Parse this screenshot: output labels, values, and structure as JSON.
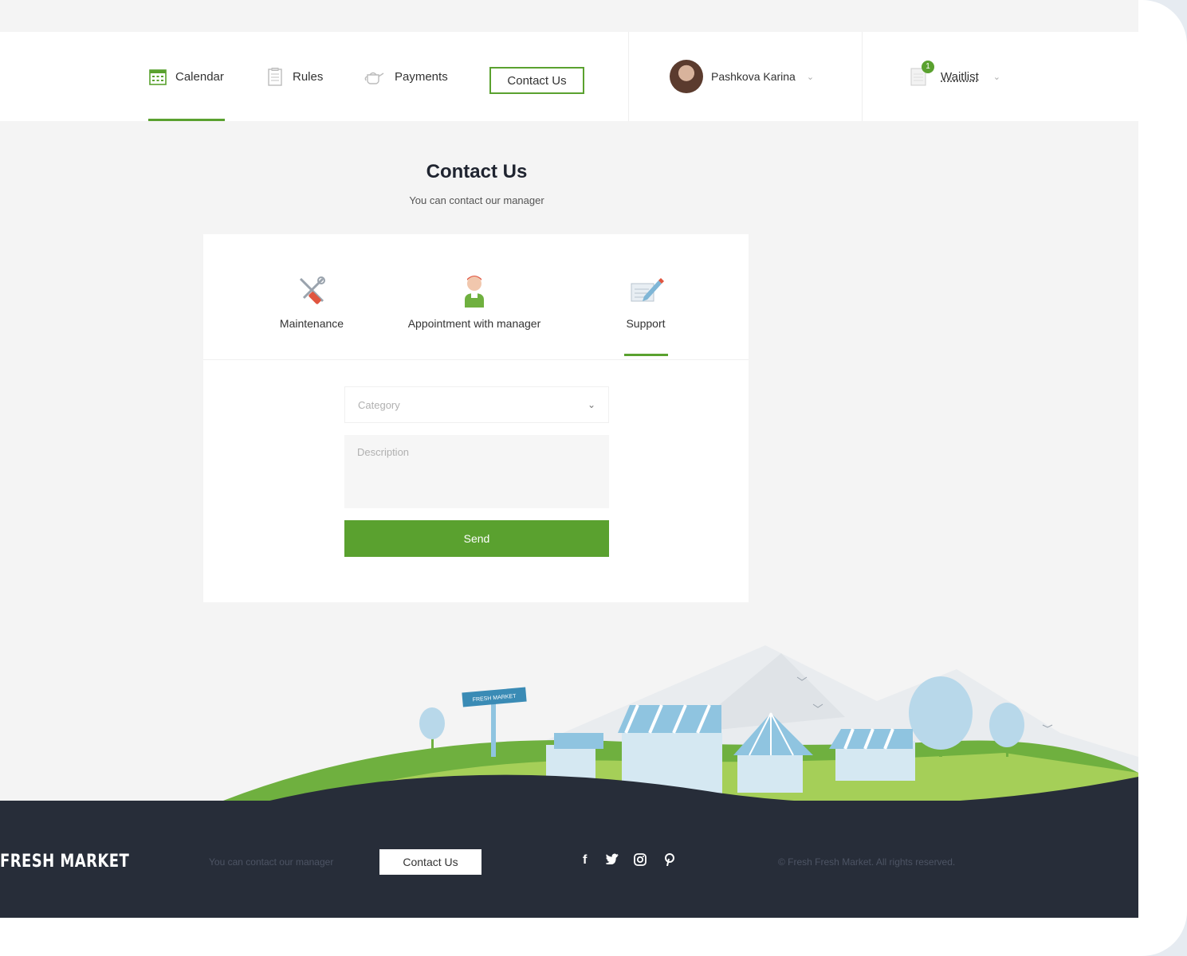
{
  "nav": {
    "calendar": "Calendar",
    "rules": "Rules",
    "payments": "Payments",
    "contact": "Contact Us"
  },
  "user": {
    "name": "Pashkova Karina"
  },
  "waitlist": {
    "label": "Waitlist",
    "badge": "1"
  },
  "page": {
    "title": "Contact Us",
    "subtitle": "You can contact our manager"
  },
  "tabs": [
    {
      "label": "Maintenance",
      "icon": "tools-icon"
    },
    {
      "label": "Appointment with manager",
      "icon": "manager-icon"
    },
    {
      "label": "Support",
      "icon": "support-icon",
      "active": true
    }
  ],
  "form": {
    "category_placeholder": "Category",
    "description_placeholder": "Description",
    "send_label": "Send"
  },
  "illustration": {
    "sign_text": "FRESH MARKET"
  },
  "footer": {
    "brand": "FRESH MARKET",
    "subtitle": "You can contact our manager",
    "contact_label": "Contact Us",
    "social": [
      "facebook-icon",
      "twitter-icon",
      "instagram-icon",
      "pinterest-icon"
    ],
    "copyright": "© Fresh Fresh Market. All rights reserved."
  },
  "colors": {
    "accent": "#5aa12f",
    "footer": "#272d39",
    "page": "#f4f4f4"
  }
}
